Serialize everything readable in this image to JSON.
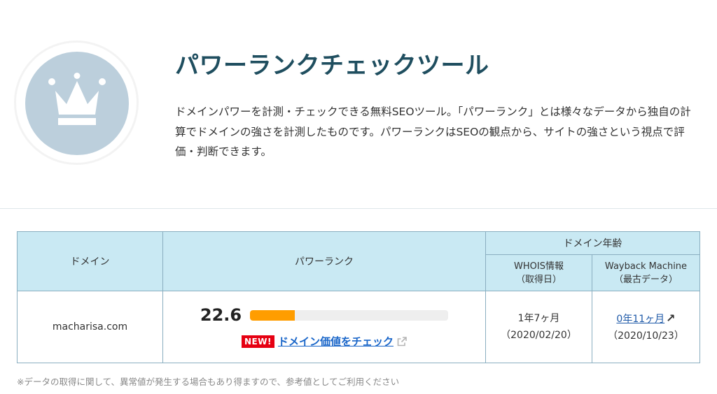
{
  "header": {
    "title": "パワーランクチェックツール",
    "description": "ドメインパワーを計測・チェックできる無料SEOツール。「パワーランク」とは様々なデータから独自の計算でドメインの強さを計測したものです。パワーランクはSEOの観点から、サイトの強さという視点で評価・判断できます。",
    "logo_icon": "crown-icon"
  },
  "table": {
    "headers": {
      "domain": "ドメイン",
      "power_rank": "パワーランク",
      "domain_age": "ドメイン年齢",
      "whois_line1": "WHOIS情報",
      "whois_line2": "（取得日）",
      "wayback_line1": "Wayback Machine",
      "wayback_line2": "（最古データ）"
    },
    "row": {
      "domain": "macharisa.com",
      "power_rank": "22.6",
      "power_rank_bar_fraction": 0.226,
      "new_badge": "NEW!",
      "check_link": "ドメイン価値をチェック",
      "whois_age": "1年7ヶ月",
      "whois_date": "（2020/02/20）",
      "wayback_age": "0年11ヶ月",
      "wayback_date": "（2020/10/23）"
    }
  },
  "note": "※データの取得に関して、異常値が発生する場合もあり得ますので、参考値としてご利用ください",
  "colors": {
    "bar_fill": "#ff9d00",
    "header_bg": "#c9e9f3",
    "title": "#1f4e5f",
    "link": "#1a66c9",
    "badge": "#e60012"
  }
}
